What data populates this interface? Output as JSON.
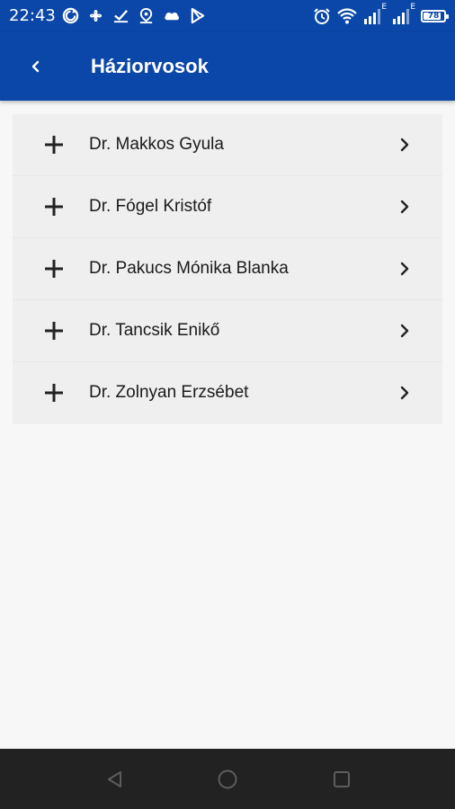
{
  "status_bar": {
    "time": "22:43",
    "battery_level": "78",
    "network_label_1": "E",
    "network_label_2": "E",
    "left_icons": [
      "sync-icon",
      "fan-icon",
      "check-icon",
      "location-icon",
      "cloud-icon",
      "play-store-icon"
    ],
    "right_icons": [
      "alarm-icon",
      "wifi-icon",
      "signal-icon",
      "signal-icon",
      "battery-icon"
    ]
  },
  "app_bar": {
    "title": "Háziorvosok",
    "back_icon": "chevron-left-icon",
    "color": "#0b47a8"
  },
  "doctors": [
    {
      "label": "Dr. Makkos Gyula"
    },
    {
      "label": "Dr. Fógel Kristóf"
    },
    {
      "label": "Dr. Pakucs Mónika Blanka"
    },
    {
      "label": "Dr. Tancsik Enikő"
    },
    {
      "label": "Dr. Zolnyan Erzsébet"
    }
  ],
  "icons": {
    "leading": "plus-icon",
    "trailing": "chevron-right-icon"
  },
  "nav_bar": {
    "buttons": [
      "back-triangle-icon",
      "home-circle-icon",
      "recents-square-icon"
    ]
  }
}
